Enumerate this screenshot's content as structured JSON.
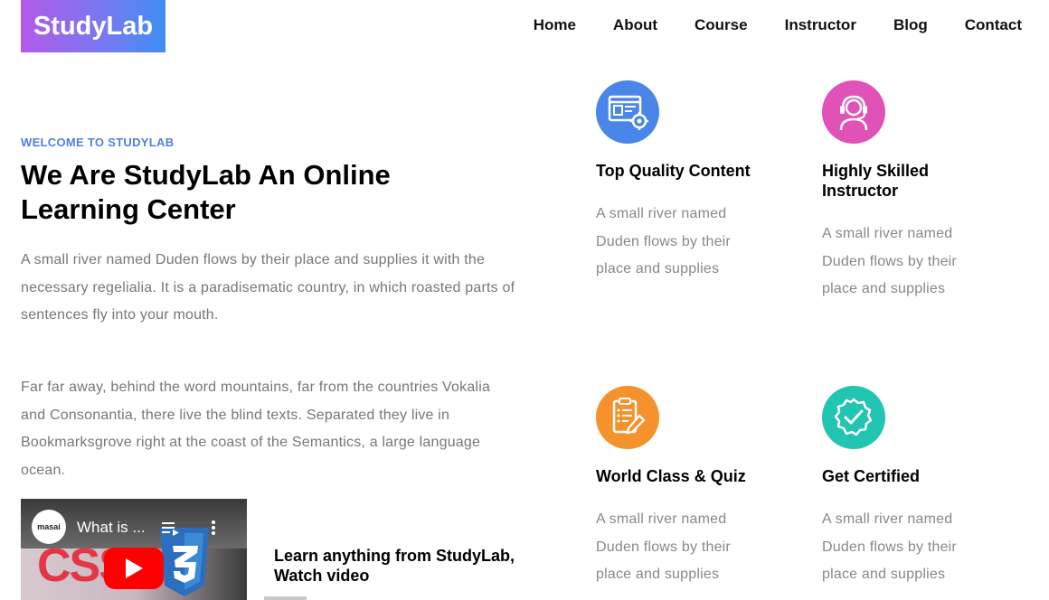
{
  "brand": {
    "name": "StudyLab"
  },
  "nav": {
    "items": [
      "Home",
      "About",
      "Course",
      "Instructor",
      "Blog",
      "Contact"
    ]
  },
  "hero": {
    "eyebrow": "WELCOME TO STUDYLAB",
    "headline": "We Are StudyLab An Online Learning Center",
    "paragraph1": "A small river named Duden flows by their place and supplies it with the necessary regelialia. It is a paradisematic country, in which roasted parts of sentences fly into your mouth.",
    "paragraph2": "Far far away, behind the word mountains, far from the countries Vokalia and Consonantia, there live the blind texts. Separated they live in Bookmarksgrove right at the coast of the Semantics, a large language ocean."
  },
  "video": {
    "channel": "masai",
    "title": "What is ...",
    "caption": "Learn anything from StudyLab, Watch video"
  },
  "features": [
    {
      "title": "Top Quality Content",
      "text": "A small river named Duden flows by their place and supplies",
      "icon": "content-settings-icon",
      "color": "#4a86e8"
    },
    {
      "title": "Highly Skilled Instructor",
      "text": "A small river named Duden flows by their place and supplies",
      "icon": "headset-instructor-icon",
      "color": "#e052b8"
    },
    {
      "title": "World Class & Quiz",
      "text": "A small river named Duden flows by their place and supplies",
      "icon": "quiz-document-icon",
      "color": "#f5922b"
    },
    {
      "title": "Get Certified",
      "text": "A small river named Duden flows by their place and supplies",
      "icon": "certified-badge-icon",
      "color": "#22c4b2"
    }
  ],
  "colors": {
    "accent": "#4f7fe3",
    "logo_gradient_start": "#b25ae8",
    "logo_gradient_end": "#3f8ef2"
  }
}
